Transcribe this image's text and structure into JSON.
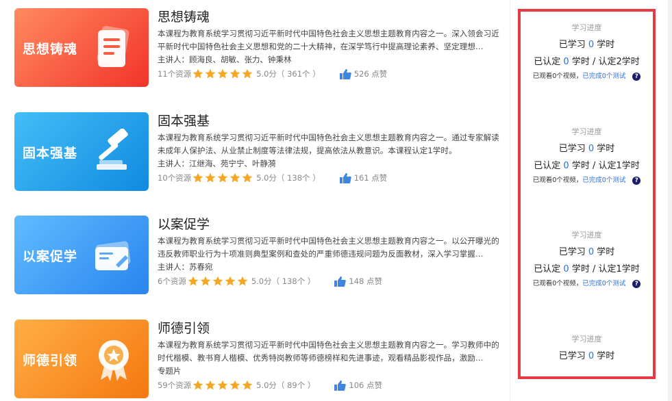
{
  "courses": [
    {
      "thumb_label": "思想铸魂",
      "thumb_colors": [
        "#ff7a55",
        "#f23a2e"
      ],
      "title": "思想铸魂",
      "desc": "本课程为教育系统学习贯彻习近平新时代中国特色社会主义思想主题教育内容之一。深入领会习近平新时代中国特色社会主义思想和党的二十大精神，在深学笃行中提高理论素养、坚定理想…",
      "lecturer": "主讲人：顾海良、胡敏、张力、钟秉林",
      "resources": "11个资源",
      "rating": 5,
      "score": "5.0分（ 361个 ）",
      "likes": "526 点赞",
      "icon": "document-icon"
    },
    {
      "thumb_label": "固本强基",
      "thumb_colors": [
        "#3bb3f5",
        "#128de0"
      ],
      "title": "固本强基",
      "desc": "本课程为教育系统学习贯彻习近平新时代中国特色社会主义思想主题教育内容之一。通过专家解读未成年人保护法、从业禁止制度等法律法规，提高依法从教意识。本课程认定1学时。",
      "lecturer": "主讲人：江继海、苑宁宁、叶静漪",
      "resources": "10个资源",
      "rating": 5,
      "score": "5.0分（ 138个 ）",
      "likes": "161 点赞",
      "icon": "gavel-icon"
    },
    {
      "thumb_label": "以案促学",
      "thumb_colors": [
        "#55b6ff",
        "#2a86f0"
      ],
      "title": "以案促学",
      "desc": "本课程为教育系统学习贯彻习近平新时代中国特色社会主义思想主题教育内容之一。以公开曝光的违反教师职业行为十项准则典型案例和查处的严重师德违规问题为反面教材，深入学习掌握…",
      "lecturer": "主讲人：苏春宛",
      "resources": "6个资源",
      "rating": 5,
      "score": "5.0分（ 138个 ）",
      "likes": "148 点赞",
      "icon": "card-icon"
    },
    {
      "thumb_label": "师德引领",
      "thumb_colors": [
        "#ffa43a",
        "#f57a12"
      ],
      "title": "师德引领",
      "desc": "本课程为教育系统学习贯彻习近平新时代中国特色社会主义思想主题教育内容之一。学习教师中的时代楷模、教书育人楷模、优秀特岗教师等师德榜样和先进事迹，观看精品影视作品，激励…",
      "desc_extra": "专题片",
      "lecturer": "",
      "resources": "59个资源",
      "rating": 5,
      "score": "5.0分（ 89个 ）",
      "likes": "106 点赞",
      "icon": "medal-icon"
    }
  ],
  "progress": [
    {
      "title": "学习进度",
      "studied_pre": "已学习",
      "studied_num": "0",
      "studied_post": "学时",
      "cert_pre": "已认定",
      "cert_num": "0",
      "cert_post": "学时 / 认定2学时",
      "watched": "已观看0个视频，",
      "tests": "已完成0个测试",
      "help": "?"
    },
    {
      "title": "学习进度",
      "studied_pre": "已学习",
      "studied_num": "0",
      "studied_post": "学时",
      "cert_pre": "已认定",
      "cert_num": "0",
      "cert_post": "学时 / 认定1学时",
      "watched": "已观看0个视频，",
      "tests": "已完成0个测试",
      "help": "?"
    },
    {
      "title": "学习进度",
      "studied_pre": "已学习",
      "studied_num": "0",
      "studied_post": "学时",
      "cert_pre": "已认定",
      "cert_num": "0",
      "cert_post": "学时 / 认定1学时",
      "watched": "已观看0个视频，",
      "tests": "已完成0个测试",
      "help": "?"
    },
    {
      "title": "学习进度",
      "studied_pre": "已学习",
      "studied_num": "0",
      "studied_post": "学时"
    }
  ],
  "colors": {
    "highlight_border": "#e83a45",
    "accent_blue": "#2f6fd6",
    "star": "#f5a623",
    "like": "#3e86e0"
  }
}
